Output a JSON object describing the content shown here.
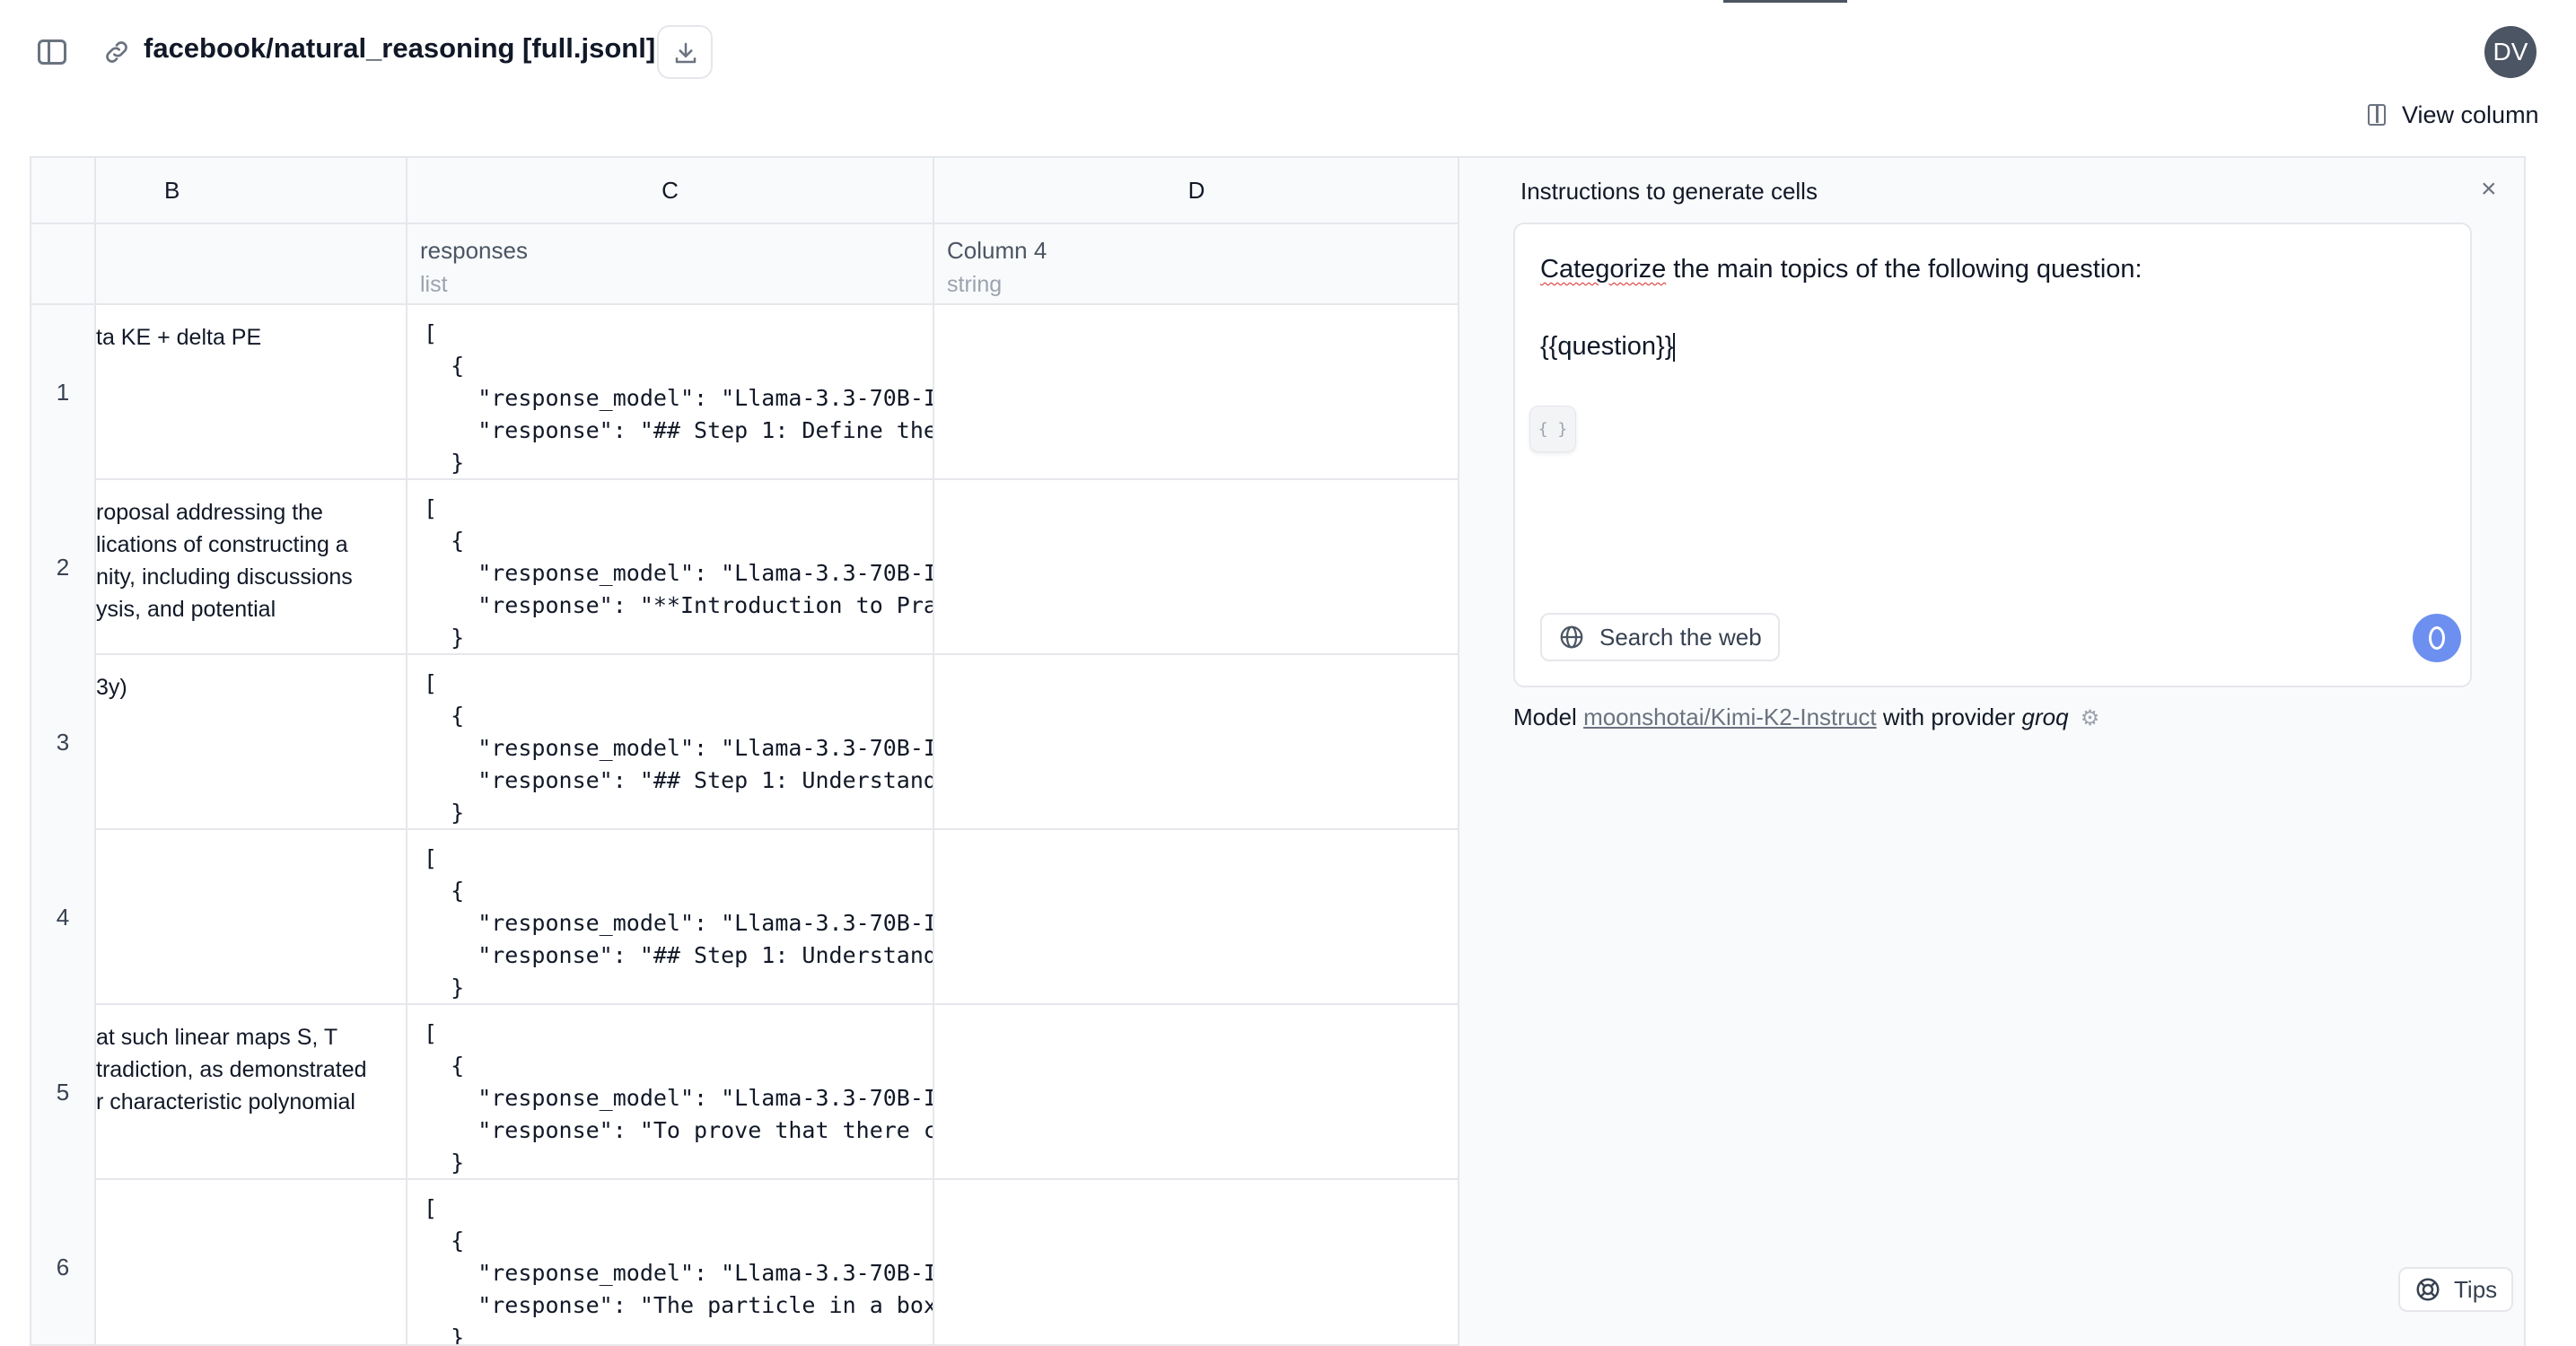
{
  "header": {
    "dataset_title": "facebook/natural_reasoning [full.jsonl]",
    "avatar_initials": "DV",
    "view_column_label": "View column"
  },
  "table": {
    "columns": [
      {
        "letter": "B",
        "name": "",
        "type": ""
      },
      {
        "letter": "C",
        "name": "responses",
        "type": "list"
      },
      {
        "letter": "D",
        "name": "Column 4",
        "type": "string"
      }
    ],
    "rows": [
      {
        "index": "1",
        "b": "ta KE + delta PE",
        "c": "[\n  {\n    \"response_model\": \"Llama-3.3-70B-I\n    \"response\": \"## Step 1: Define the\n  }",
        "d": ""
      },
      {
        "index": "2",
        "b": "roposal addressing the\nlications of constructing a\nnity, including discussions\nysis, and potential",
        "c": "[\n  {\n    \"response_model\": \"Llama-3.3-70B-I\n    \"response\": \"**Introduction to Pra\n  }",
        "d": ""
      },
      {
        "index": "3",
        "b": "3y)",
        "c": "[\n  {\n    \"response_model\": \"Llama-3.3-70B-I\n    \"response\": \"## Step 1: Understand\n  }",
        "d": ""
      },
      {
        "index": "4",
        "b": "",
        "c": "[\n  {\n    \"response_model\": \"Llama-3.3-70B-I\n    \"response\": \"## Step 1: Understand\n  }",
        "d": ""
      },
      {
        "index": "5",
        "b": "at such linear maps S, T\ntradiction, as demonstrated\nr characteristic polynomial",
        "c": "[\n  {\n    \"response_model\": \"Llama-3.3-70B-I\n    \"response\": \"To prove that there c\n  }",
        "d": ""
      },
      {
        "index": "6",
        "b": "",
        "c": "[\n  {\n    \"response_model\": \"Llama-3.3-70B-I\n    \"response\": \"The particle in a box\n  }",
        "d": ""
      }
    ]
  },
  "panel": {
    "title": "Instructions to generate cells",
    "prompt_word1": "Categorize",
    "prompt_rest": " the main topics of the following question:",
    "prompt_var": "{{question}}",
    "braces_label": "{ }",
    "search_web_label": "Search the web",
    "model_prefix": "Model",
    "model_name": "moonshotai/Kimi-K2-Instruct",
    "model_middle": "with provider",
    "provider": "groq",
    "tips_label": "Tips",
    "accent_color": "#6d8ff0"
  }
}
